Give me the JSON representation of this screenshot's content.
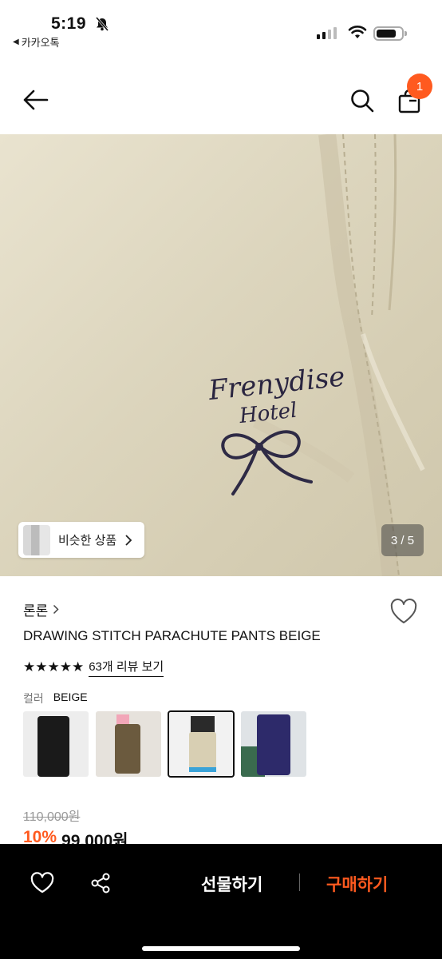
{
  "status": {
    "time": "5:19",
    "back_app": "카카오톡"
  },
  "header": {
    "cart_count": "1"
  },
  "hero": {
    "similar_label": "비슷한 상품",
    "image_counter": "3 / 5",
    "embroidery_line1": "Frenydise",
    "embroidery_line2": "Hotel"
  },
  "product": {
    "brand": "론론",
    "name": "DRAWING STITCH PARACHUTE PANTS BEIGE",
    "stars": "★★★★★",
    "review_link": "63개 리뷰 보기",
    "color_label": "컬러",
    "color_value": "BEIGE",
    "price_original": "110,000원",
    "discount": "10%",
    "price_sale": "99,000원"
  },
  "bottom": {
    "gift_label": "선물하기",
    "buy_label": "구매하기"
  },
  "colors": {
    "accent": "#ff5a1f",
    "bar": "#000000"
  }
}
